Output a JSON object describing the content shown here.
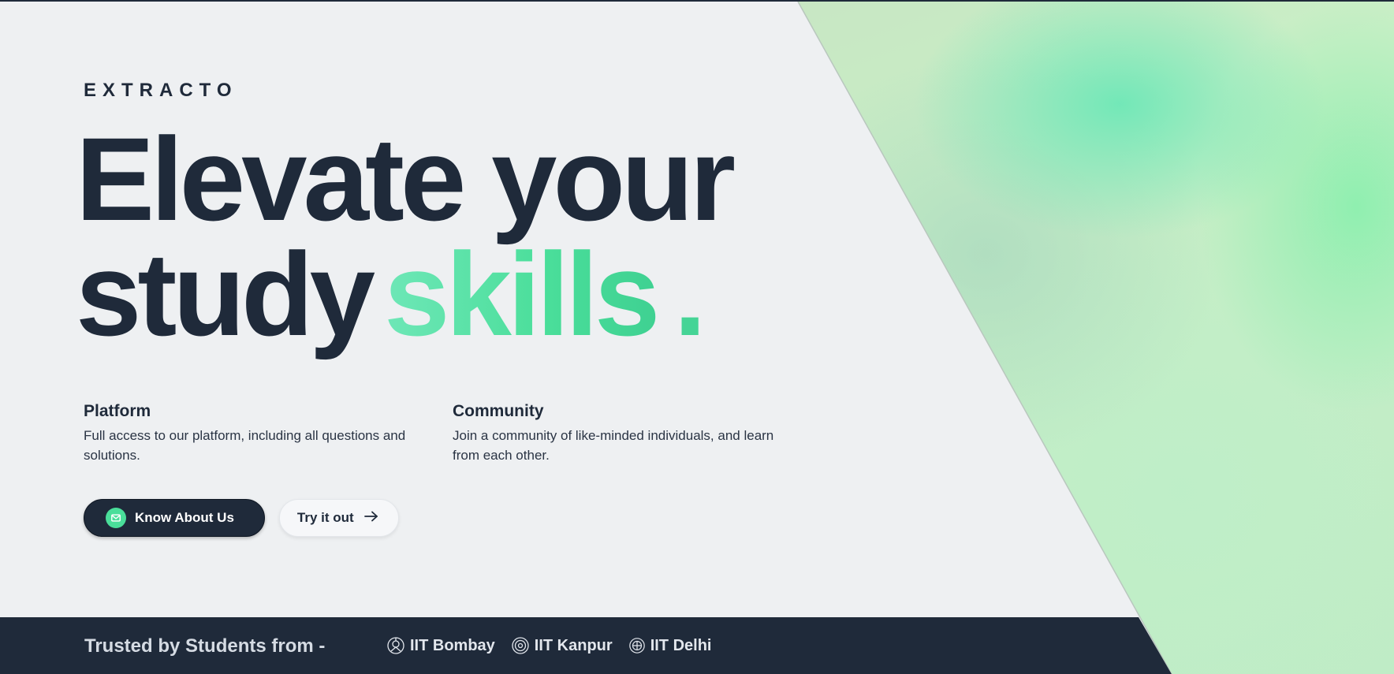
{
  "brand": {
    "name": "EXTRACTO"
  },
  "hero": {
    "headline_line1": "Elevate your",
    "headline_word": "study",
    "headline_accent": "skills",
    "headline_dot": ".",
    "accent_color": "#4ade9a"
  },
  "features": {
    "platform": {
      "title": "Platform",
      "description": "Full access to our platform, including all questions and solutions."
    },
    "community": {
      "title": "Community",
      "description": "Join a community of like-minded individuals, and learn from each other."
    }
  },
  "actions": {
    "primary_label": "Know About Us",
    "primary_icon": "mail-icon",
    "secondary_label": "Try it out",
    "secondary_icon": "arrow-right-icon"
  },
  "trust": {
    "label": "Trusted by Students from -",
    "institutions": [
      {
        "name": "IIT Bombay",
        "icon": "iit-bombay-emblem-icon"
      },
      {
        "name": "IIT Kanpur",
        "icon": "iit-kanpur-emblem-icon"
      },
      {
        "name": "IIT Delhi",
        "icon": "iit-delhi-emblem-icon"
      }
    ],
    "bar_color": "#1f2a3a"
  },
  "colors": {
    "background": "#eef0f2",
    "text": "#1f2a3a",
    "gradient_green": "#6ee7b7"
  }
}
